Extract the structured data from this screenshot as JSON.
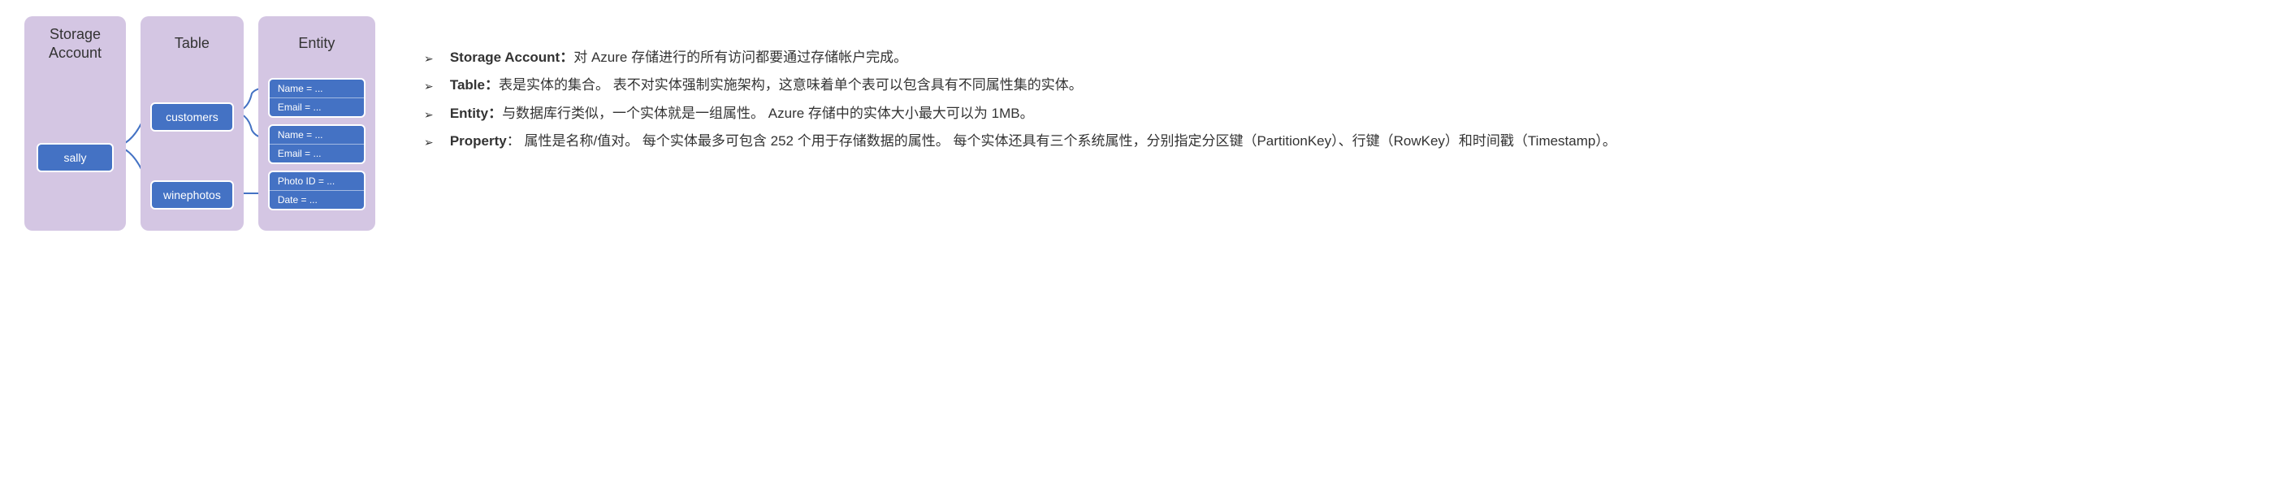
{
  "diagram": {
    "columns": {
      "storage": {
        "header": "Storage\nAccount",
        "nodes": [
          "sally"
        ]
      },
      "table": {
        "header": "Table",
        "nodes": [
          "customers",
          "winephotos"
        ]
      },
      "entity": {
        "header": "Entity",
        "nodes": [
          {
            "lines": [
              "Name = ...",
              "Email = ..."
            ]
          },
          {
            "lines": [
              "Name = ...",
              "Email = ..."
            ]
          },
          {
            "lines": [
              "Photo ID = ...",
              "Date = ..."
            ]
          }
        ]
      }
    }
  },
  "descriptions": [
    {
      "term": "Storage Account",
      "colon": "：",
      "text": "对 Azure 存储进行的所有访问都要通过存储帐户完成。"
    },
    {
      "term": "Table",
      "colon": "：",
      "text": "表是实体的集合。 表不对实体强制实施架构，这意味着单个表可以包含具有不同属性集的实体。"
    },
    {
      "term": "Entity",
      "colon": "：",
      "text": "与数据库行类似，一个实体就是一组属性。 Azure 存储中的实体大小最大可以为 1MB。"
    },
    {
      "term": "Property",
      "colon": "：",
      "text": " 属性是名称/值对。 每个实体最多可包含 252 个用于存储数据的属性。 每个实体还具有三个系统属性，分别指定分区键（PartitionKey）、行键（RowKey）和时间戳（Timestamp）。"
    }
  ],
  "bulletGlyph": "➢"
}
